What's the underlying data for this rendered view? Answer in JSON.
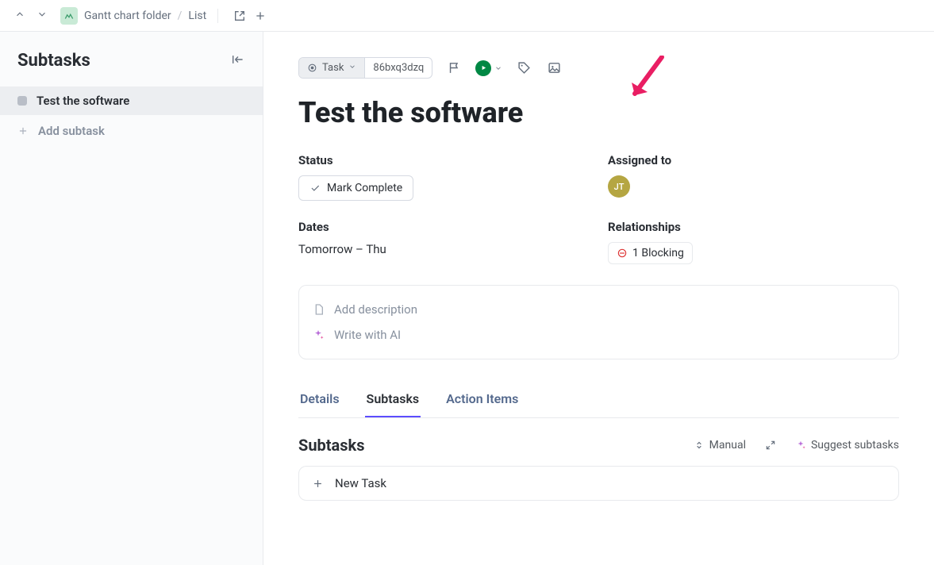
{
  "breadcrumb": {
    "folder": "Gantt chart folder",
    "view": "List"
  },
  "sidebar": {
    "title": "Subtasks",
    "items": [
      {
        "label": "Test the software"
      }
    ],
    "add_label": "Add subtask"
  },
  "toolbar": {
    "type_label": "Task",
    "task_id": "86bxq3dzq"
  },
  "task": {
    "title": "Test the software",
    "fields": {
      "status_label": "Status",
      "mark_complete": "Mark Complete",
      "assigned_label": "Assigned to",
      "assignee_initials": "JT",
      "dates_label": "Dates",
      "dates_value": "Tomorrow – Thu",
      "relationships_label": "Relationships",
      "blocking_text": "1 Blocking"
    },
    "desc": {
      "add": "Add description",
      "ai": "Write with AI"
    }
  },
  "tabs": {
    "details": "Details",
    "subtasks": "Subtasks",
    "action_items": "Action Items"
  },
  "subtasks_section": {
    "title": "Subtasks",
    "sort": "Manual",
    "suggest": "Suggest subtasks",
    "new_task": "New Task"
  }
}
